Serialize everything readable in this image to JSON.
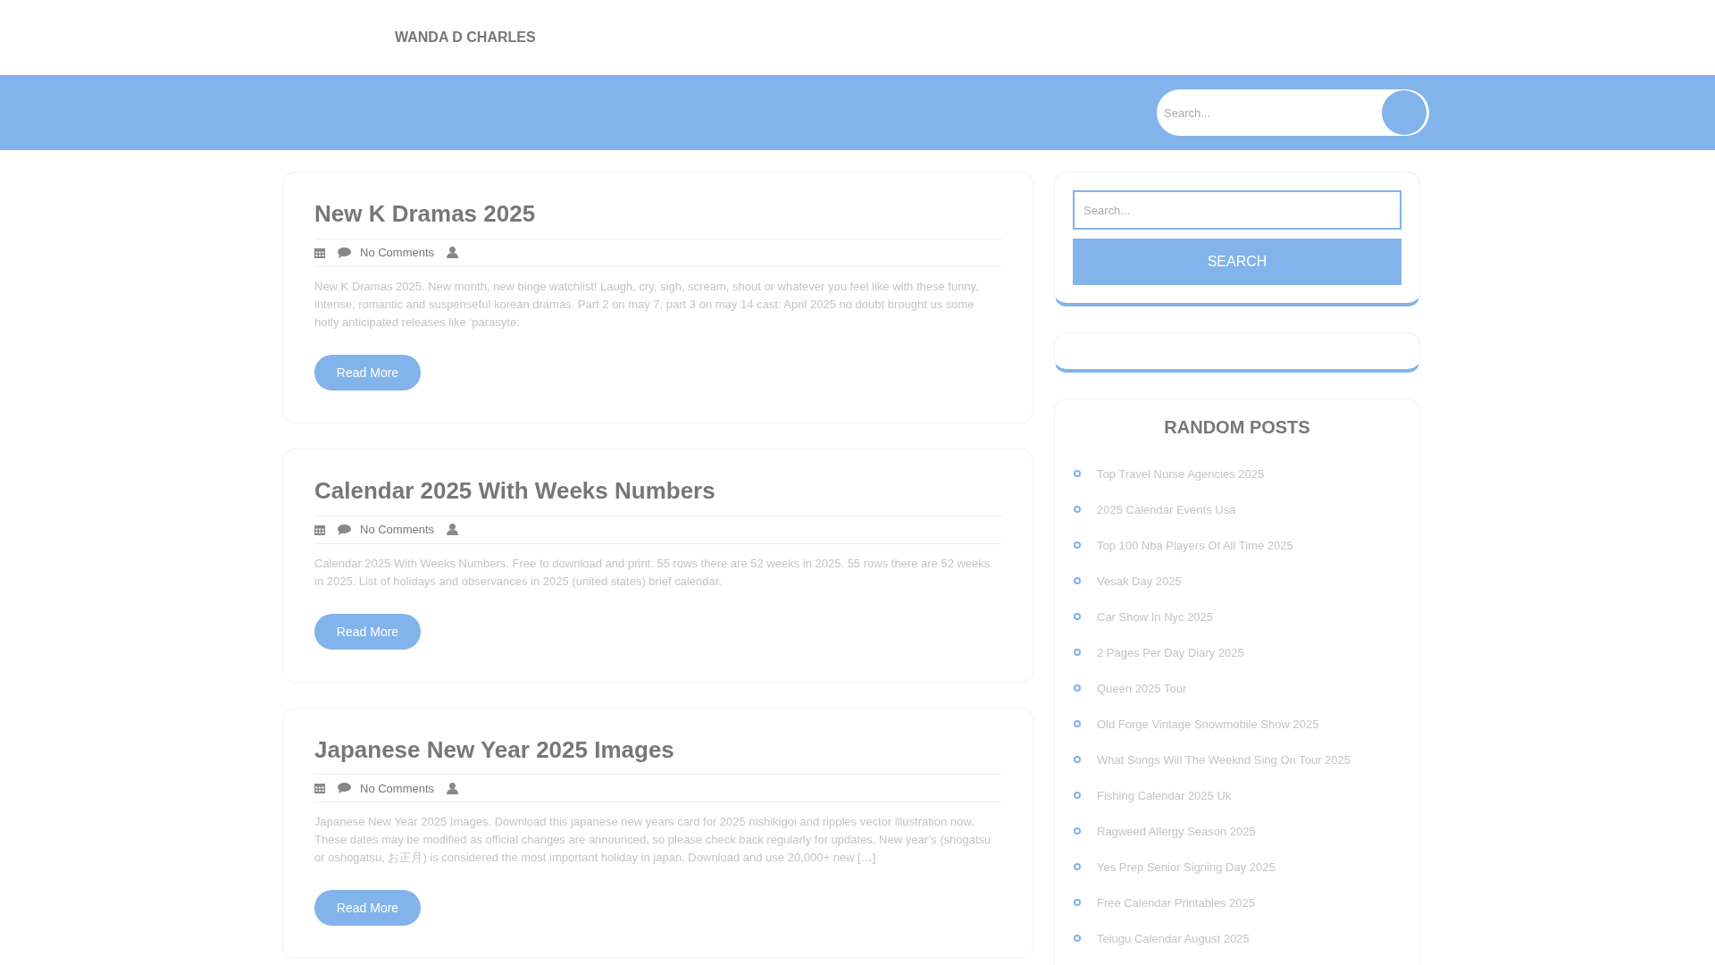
{
  "site": {
    "title": "WANDA D CHARLES"
  },
  "top_search": {
    "placeholder": "Search..."
  },
  "posts": [
    {
      "title": "New K Dramas 2025",
      "comments": "No Comments",
      "excerpt": "New K Dramas 2025. New month, new binge watchlist! Laugh, cry, sigh, scream, shout or whatever you feel like with these funny, intense, romantic and suspenseful korean dramas. Part 2 on may 7, part 3 on may 14 cast: April 2025 no doubt brought us some hotly anticipated releases like ‘parasyte:",
      "button": "Read More"
    },
    {
      "title": "Calendar 2025 With Weeks Numbers",
      "comments": "No Comments",
      "excerpt": "Calendar 2025 With Weeks Numbers. Free to download and print. 55 rows there are 52 weeks in 2025. 55 rows there are 52 weeks in 2025. List of holidays and observances in 2025 (united states) brief calendar.",
      "button": "Read More"
    },
    {
      "title": "Japanese New Year 2025 Images",
      "comments": "No Comments",
      "excerpt": "Japanese New Year 2025 Images. Download this japanese new years card for 2025 nishikigoi and ripples vector illustration now. These dates may be modified as official changes are announced, so please check back regularly for updates. New year’s (shogatsu or oshogatsu, お正月) is considered the most important holiday in japan. Download and use 20,000+ new […]",
      "button": "Read More"
    }
  ],
  "sidebar": {
    "search": {
      "placeholder": "Search...",
      "button": "SEARCH"
    },
    "random_posts": {
      "title": "RANDOM POSTS",
      "items": [
        "Top Travel Nurse Agencies 2025",
        "2025 Calendar Events Usa",
        "Top 100 Nba Players Of All Time 2025",
        "Vesak Day 2025",
        "Car Show In Nyc 2025",
        "2 Pages Per Day Diary 2025",
        "Queen 2025 Tour",
        "Old Forge Vintage Snowmobile Show 2025",
        "What Songs Will The Weeknd Sing On Tour 2025",
        "Fishing Calendar 2025 Uk",
        "Ragweed Allergy Season 2025",
        "Yes Prep Senior Signing Day 2025",
        "Free Calendar Printables 2025",
        "Telugu Calendar August 2025"
      ]
    }
  }
}
